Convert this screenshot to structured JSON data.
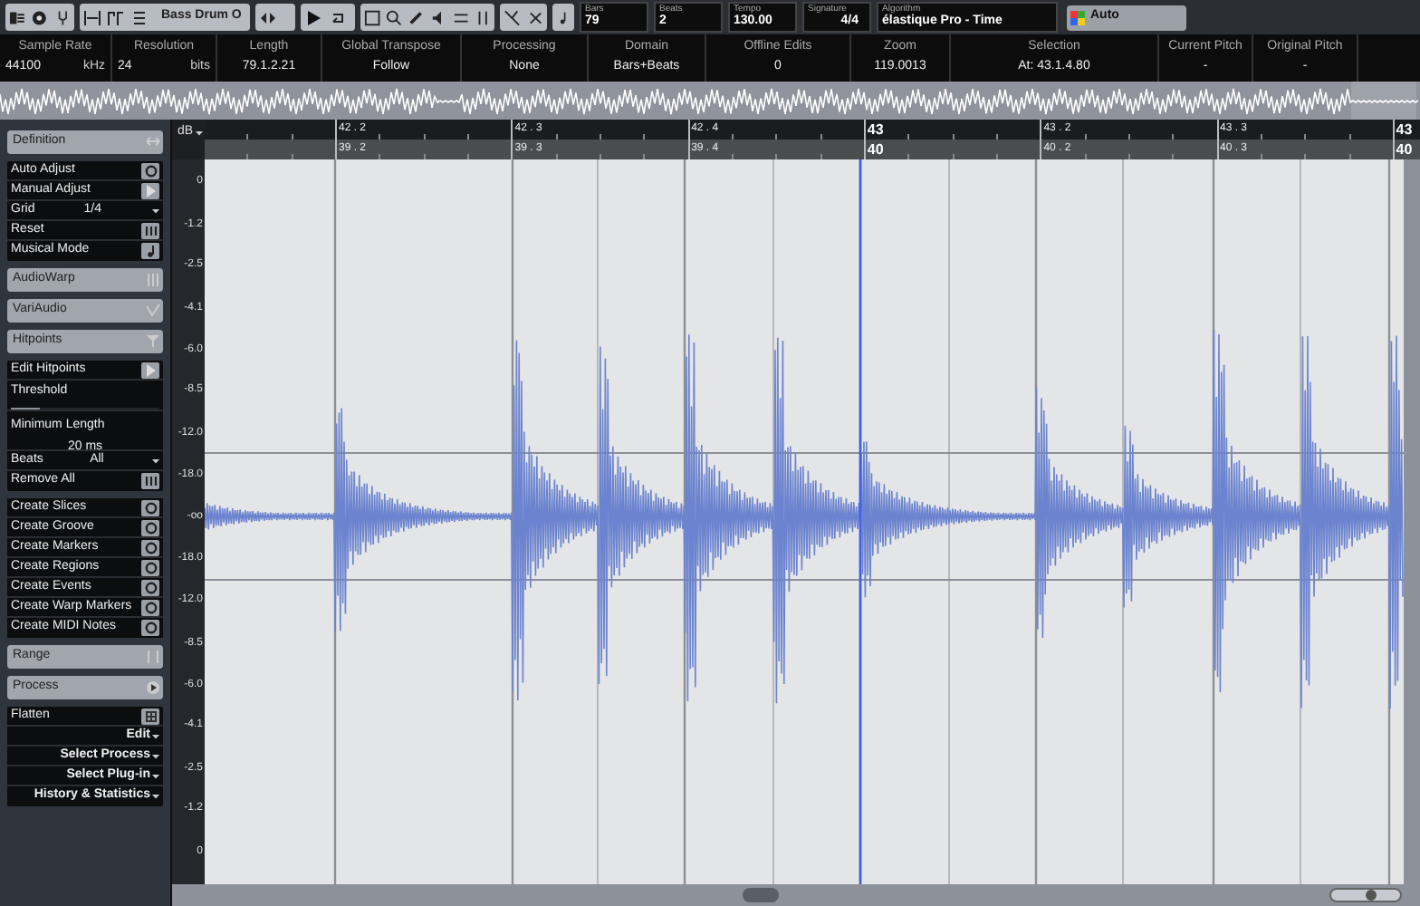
{
  "toolbar": {
    "event_name": "Bass Drum O",
    "fields": [
      {
        "label": "Bars",
        "value": "79"
      },
      {
        "label": "Beats",
        "value": "2"
      },
      {
        "label": "Tempo",
        "value": "130.00"
      },
      {
        "label": "Signature",
        "value": "4/4"
      },
      {
        "label": "Algorithm",
        "value": "élastique Pro - Time"
      }
    ],
    "preset": "Auto"
  },
  "info_line": [
    {
      "label": "Sample Rate",
      "value": "44100",
      "unit": "kHz"
    },
    {
      "label": "Resolution",
      "value": "24",
      "unit": "bits"
    },
    {
      "label": "Length",
      "value": "79.1.2.21"
    },
    {
      "label": "Global Transpose",
      "value": "Follow"
    },
    {
      "label": "Processing",
      "value": "None"
    },
    {
      "label": "Domain",
      "value": "Bars+Beats"
    },
    {
      "label": "Offline Edits",
      "value": "0"
    },
    {
      "label": "Zoom",
      "value": "119.0013"
    },
    {
      "label": "Selection",
      "value": "At: 43.1.4.80"
    },
    {
      "label": "Current Pitch",
      "value": "-"
    },
    {
      "label": "Original Pitch",
      "value": "-"
    }
  ],
  "sidebar": {
    "sections": [
      {
        "title": "Definition",
        "rows": [
          {
            "kind": "push",
            "label": "Auto Adjust"
          },
          {
            "kind": "play",
            "label": "Manual Adjust"
          },
          {
            "kind": "value",
            "label": "Grid",
            "value": "1/4"
          },
          {
            "kind": "reset",
            "label": "Reset"
          },
          {
            "kind": "note",
            "label": "Musical Mode"
          }
        ]
      },
      {
        "title": "AudioWarp"
      },
      {
        "title": "VariAudio"
      },
      {
        "title": "Hitpoints",
        "rows": [
          {
            "kind": "play",
            "label": "Edit Hitpoints"
          },
          {
            "kind": "level",
            "label": "Threshold",
            "level": 0.2
          },
          {
            "kind": "field",
            "label": "Minimum Length",
            "value": "20 ms"
          },
          {
            "kind": "value",
            "label": "Beats",
            "value": "All"
          },
          {
            "kind": "reset",
            "label": "Remove All"
          }
        ],
        "actions": [
          {
            "kind": "push",
            "label": "Create Slices"
          },
          {
            "kind": "push",
            "label": "Create Groove"
          },
          {
            "kind": "push",
            "label": "Create Markers"
          },
          {
            "kind": "push",
            "label": "Create Regions"
          },
          {
            "kind": "push",
            "label": "Create Events"
          },
          {
            "kind": "push",
            "label": "Create Warp Markers"
          },
          {
            "kind": "push",
            "label": "Create MIDI Notes"
          }
        ]
      },
      {
        "title": "Range"
      },
      {
        "title": "Process",
        "rows": [
          {
            "kind": "flatten",
            "label": "Flatten"
          },
          {
            "kind": "menu",
            "label": "Edit"
          },
          {
            "kind": "menu",
            "label": "Select Process"
          },
          {
            "kind": "menu",
            "label": "Select Plug-in"
          },
          {
            "kind": "menu",
            "label": "History & Statistics"
          }
        ]
      }
    ]
  },
  "ruler": {
    "unit": "dB",
    "bars": [
      "42 . 2",
      "42 . 3",
      "42 . 4",
      "43",
      "43 . 2",
      "43 . 3",
      "43"
    ],
    "beats": [
      "39 . 2",
      "39 . 3",
      "39 . 4",
      "40",
      "40 . 2",
      "40 . 3",
      "40"
    ]
  },
  "zoom_slider": {
    "level": 0.6
  },
  "db_scale": [
    "0",
    "-1.2",
    "-2.5",
    "-4.1",
    "-6.0",
    "-8.5",
    "-12.0",
    "-18.0",
    "-oo",
    "-18.0",
    "-12.0",
    "-8.5",
    "-6.0",
    "-4.1",
    "-2.5",
    "-1.2",
    "0"
  ]
}
